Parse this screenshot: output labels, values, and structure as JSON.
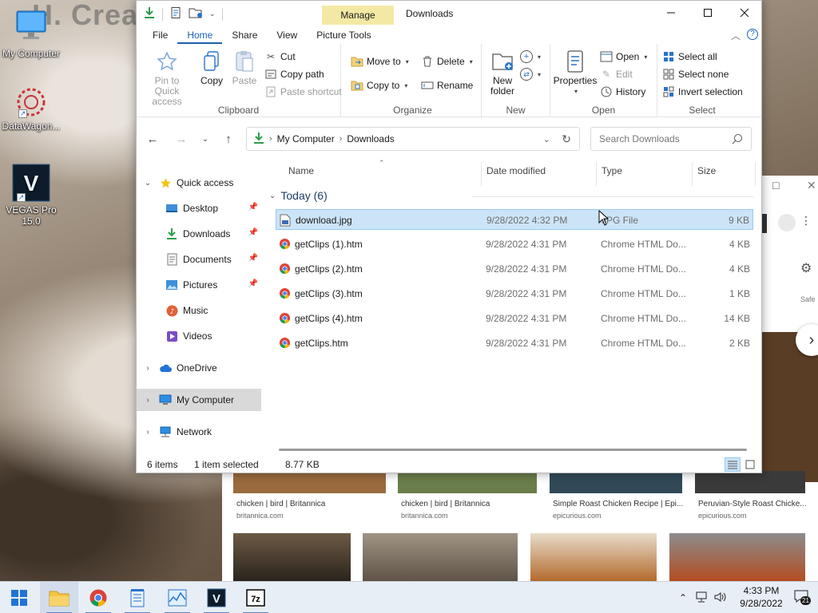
{
  "desktop": {
    "icons": [
      {
        "label": "My Computer"
      },
      {
        "label": "DataWagon..."
      },
      {
        "label": "VEGAS Pro 15.0"
      }
    ],
    "wall_text": "H. Crean"
  },
  "browser_bg": {
    "tiles": [
      {
        "title": "chicken | bird | Britannica",
        "source": "britannica.com"
      },
      {
        "title": "chicken | bird | Britannica",
        "source": "britannica.com"
      },
      {
        "title": "Simple Roast Chicken Recipe | Epi...",
        "source": "epicurious.com"
      },
      {
        "title": "Peruvian-Style Roast Chicke...",
        "source": "epicurious.com"
      }
    ],
    "side_label": "Safe"
  },
  "explorer": {
    "title": "Downloads",
    "manage_tab": "Manage",
    "tabs": [
      {
        "label": "File",
        "active": false
      },
      {
        "label": "Home",
        "active": true
      },
      {
        "label": "Share",
        "active": false
      },
      {
        "label": "View",
        "active": false
      },
      {
        "label": "Picture Tools",
        "active": false
      }
    ],
    "ribbon": {
      "clipboard": {
        "label": "Clipboard",
        "pin_label_1": "Pin to Quick",
        "pin_label_2": "access",
        "copy": "Copy",
        "paste": "Paste",
        "cut": "Cut",
        "copy_path": "Copy path",
        "paste_shortcut": "Paste shortcut"
      },
      "organize": {
        "label": "Organize",
        "move_to": "Move to",
        "copy_to": "Copy to",
        "delete": "Delete",
        "rename": "Rename"
      },
      "new": {
        "label": "New",
        "new_folder_1": "New",
        "new_folder_2": "folder"
      },
      "open": {
        "label": "Open",
        "properties": "Properties",
        "open": "Open",
        "edit": "Edit",
        "history": "History"
      },
      "select": {
        "label": "Select",
        "select_all": "Select all",
        "select_none": "Select none",
        "invert": "Invert selection"
      }
    },
    "address": {
      "crumbs": [
        "My Computer",
        "Downloads"
      ],
      "search_placeholder": "Search Downloads"
    },
    "nav": [
      {
        "label": "Quick access",
        "icon": "star-icon"
      },
      {
        "label": "Desktop",
        "icon": "desktop-folder-icon"
      },
      {
        "label": "Downloads",
        "icon": "download-arrow-icon"
      },
      {
        "label": "Documents",
        "icon": "documents-icon"
      },
      {
        "label": "Pictures",
        "icon": "pictures-icon"
      },
      {
        "label": "Music",
        "icon": "music-icon"
      },
      {
        "label": "Videos",
        "icon": "videos-icon"
      },
      {
        "label": "OneDrive",
        "icon": "cloud-icon"
      },
      {
        "label": "My Computer",
        "icon": "computer-icon"
      },
      {
        "label": "Network",
        "icon": "network-icon"
      }
    ],
    "columns": {
      "name": "Name",
      "date": "Date modified",
      "type": "Type",
      "size": "Size"
    },
    "group": "Today (6)",
    "files": [
      {
        "name": "download.jpg",
        "date": "9/28/2022 4:32 PM",
        "type": "JPG File",
        "size": "9 KB",
        "icon": "image-file-icon"
      },
      {
        "name": "getClips (1).htm",
        "date": "9/28/2022 4:31 PM",
        "type": "Chrome HTML Do...",
        "size": "4 KB",
        "icon": "chrome-icon"
      },
      {
        "name": "getClips (2).htm",
        "date": "9/28/2022 4:31 PM",
        "type": "Chrome HTML Do...",
        "size": "4 KB",
        "icon": "chrome-icon"
      },
      {
        "name": "getClips (3).htm",
        "date": "9/28/2022 4:31 PM",
        "type": "Chrome HTML Do...",
        "size": "1 KB",
        "icon": "chrome-icon"
      },
      {
        "name": "getClips (4).htm",
        "date": "9/28/2022 4:31 PM",
        "type": "Chrome HTML Do...",
        "size": "14 KB",
        "icon": "chrome-icon"
      },
      {
        "name": "getClips.htm",
        "date": "9/28/2022 4:31 PM",
        "type": "Chrome HTML Do...",
        "size": "2 KB",
        "icon": "chrome-icon"
      }
    ],
    "status": {
      "items": "6 items",
      "selected": "1 item selected",
      "size": "8.77 KB"
    }
  },
  "taskbar": {
    "time": "4:33 PM",
    "date": "9/28/2022",
    "notification_count": "21"
  },
  "colors": {
    "accent": "#1a5fb4",
    "selection": "#cce4f7",
    "manage_tab": "#f4e9a4"
  }
}
